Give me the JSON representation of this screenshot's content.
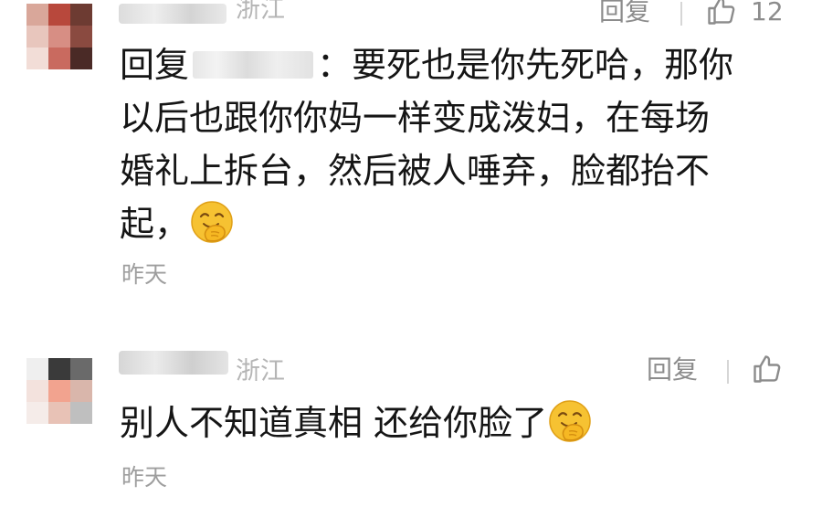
{
  "comments": [
    {
      "location": "浙江",
      "reply_label": "回复",
      "like_count": "12",
      "reply_prefix": "回复",
      "lines": [
        "：要死也是你先死哈，那你",
        "以后也跟你你妈一样变成泼妇，在每场",
        "婚礼上拆台，然后被人唾弃，脸都抬不",
        "起，"
      ],
      "emoji": "laughing-cover-mouth-emoji",
      "time": "昨天"
    },
    {
      "location": "浙江",
      "reply_label": "回复",
      "text": "别人不知道真相 还给你脸了",
      "emoji": "laughing-cover-mouth-emoji",
      "time": "昨天"
    }
  ],
  "colors": {
    "text": "#151515",
    "meta": "#8c8c8c",
    "location": "#b5b5b5",
    "time": "#9e9e9e",
    "emoji": "#f6c232"
  },
  "icons": [
    "thumbs-up-icon",
    "laughing-cover-mouth-emoji"
  ]
}
